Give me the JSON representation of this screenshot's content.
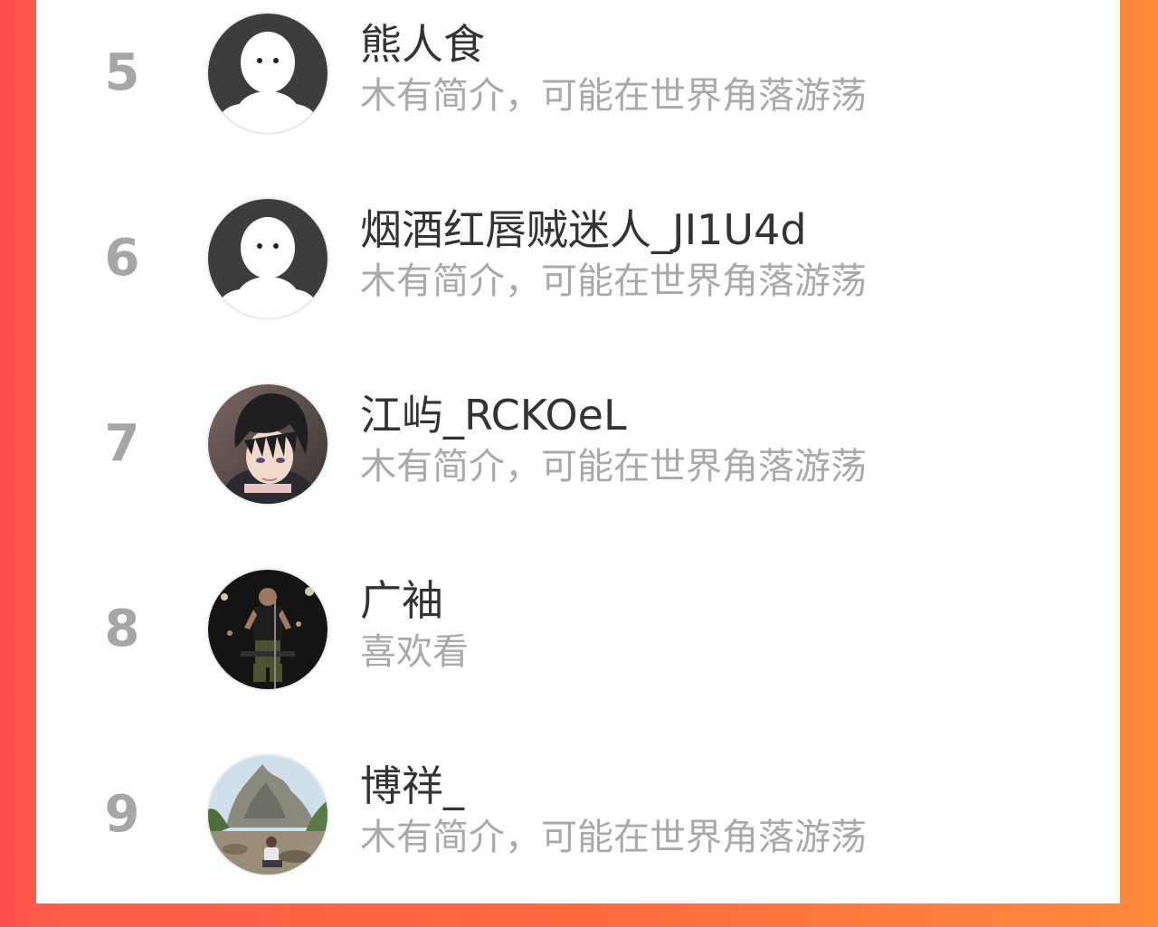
{
  "colors": {
    "background_left": "#ff4a4f",
    "background_right": "#ff8a3a",
    "panel": "#ffffff",
    "rank_text": "#a6a6a6",
    "name_text": "#333333",
    "bio_text": "#a9a9a9"
  },
  "list": {
    "items": [
      {
        "rank": "5",
        "name": "熊人食",
        "bio": "木有简介，可能在世界角落游荡",
        "avatar": "default-ghost-avatar-icon"
      },
      {
        "rank": "6",
        "name": "烟酒红唇贼迷人_JI1U4d",
        "bio": "木有简介，可能在世界角落游荡",
        "avatar": "default-ghost-avatar-icon"
      },
      {
        "rank": "7",
        "name": "江屿_RCKOeL",
        "bio": "木有简介，可能在世界角落游荡",
        "avatar": "anime-boy-avatar"
      },
      {
        "rank": "8",
        "name": "广袖",
        "bio": "喜欢看",
        "avatar": "singer-on-stage-avatar"
      },
      {
        "rank": "9",
        "name": "博祥_",
        "bio": "木有简介，可能在世界角落游荡",
        "avatar": "rock-garden-photo-avatar"
      }
    ]
  }
}
